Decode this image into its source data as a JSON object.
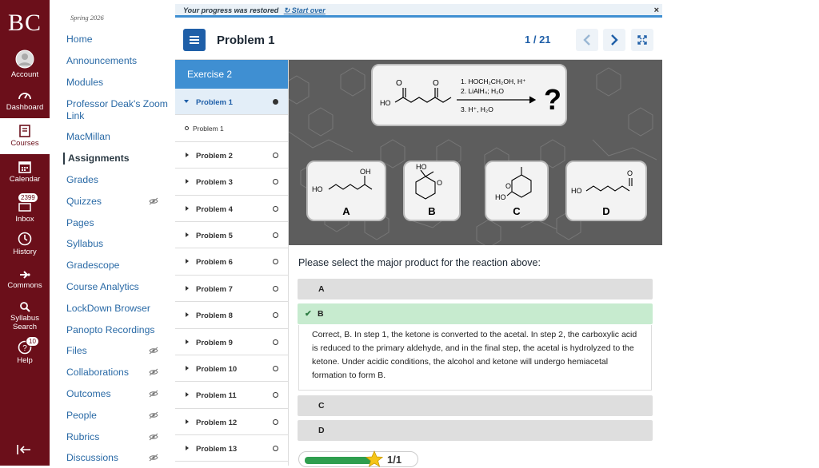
{
  "global_nav": {
    "logo": "BC",
    "items": [
      {
        "label": "Account"
      },
      {
        "label": "Dashboard"
      },
      {
        "label": "Courses"
      },
      {
        "label": "Calendar"
      },
      {
        "label": "Inbox",
        "badge": "2399"
      },
      {
        "label": "History"
      },
      {
        "label": "Commons"
      },
      {
        "label": "Syllabus Search"
      },
      {
        "label": "Help",
        "badge": "10"
      }
    ]
  },
  "course_nav": {
    "term": "Spring 2026",
    "items": [
      {
        "label": "Home"
      },
      {
        "label": "Announcements"
      },
      {
        "label": "Modules"
      },
      {
        "label": "Professor Deak's Zoom Link"
      },
      {
        "label": "MacMillan"
      },
      {
        "label": "Assignments"
      },
      {
        "label": "Grades"
      },
      {
        "label": "Quizzes"
      },
      {
        "label": "Pages"
      },
      {
        "label": "Syllabus"
      },
      {
        "label": "Gradescope"
      },
      {
        "label": "Course Analytics"
      },
      {
        "label": "LockDown Browser"
      },
      {
        "label": "Panopto Recordings"
      },
      {
        "label": "Files"
      },
      {
        "label": "Collaborations"
      },
      {
        "label": "Outcomes"
      },
      {
        "label": "People"
      },
      {
        "label": "Rubrics"
      },
      {
        "label": "Discussions"
      }
    ]
  },
  "banner": {
    "text": "Your progress was restored",
    "start_over": "Start over",
    "close": "×"
  },
  "header": {
    "title": "Problem 1",
    "counter": "1 / 21"
  },
  "problem_list": {
    "exercise": "Exercise 2",
    "items": [
      {
        "label": "Problem 1"
      },
      {
        "label": "Problem 1"
      },
      {
        "label": "Problem 2"
      },
      {
        "label": "Problem 3"
      },
      {
        "label": "Problem 4"
      },
      {
        "label": "Problem 5"
      },
      {
        "label": "Problem 6"
      },
      {
        "label": "Problem 7"
      },
      {
        "label": "Problem 8"
      },
      {
        "label": "Problem 9"
      },
      {
        "label": "Problem 10"
      },
      {
        "label": "Problem 11"
      },
      {
        "label": "Problem 12"
      },
      {
        "label": "Problem 13"
      }
    ]
  },
  "reaction": {
    "step1": "1. HOCH₂CH₂OH, H⁺",
    "step2": "2. LiAlH₄; H₂O",
    "step3": "3. H⁺, H₂O",
    "unknown": "?",
    "sm_label": "HO",
    "choices": [
      "A",
      "B",
      "C",
      "D"
    ],
    "ho": "HO",
    "oh": "OH",
    "o": "O"
  },
  "question": {
    "prompt": "Please select the major product for the reaction above:",
    "options": [
      "A",
      "B",
      "C",
      "D"
    ],
    "feedback": "Correct, B.  In step 1, the ketone is converted to the acetal.  In step 2, the carboxylic acid is reduced to the primary aldehyde, and in the final step, the acetal is hydrolyzed to the ketone.  Under acidic conditions, the alcohol and ketone will undergo hemiacetal formation to form B.",
    "score": "1/1",
    "score_fraction": 0.6
  }
}
